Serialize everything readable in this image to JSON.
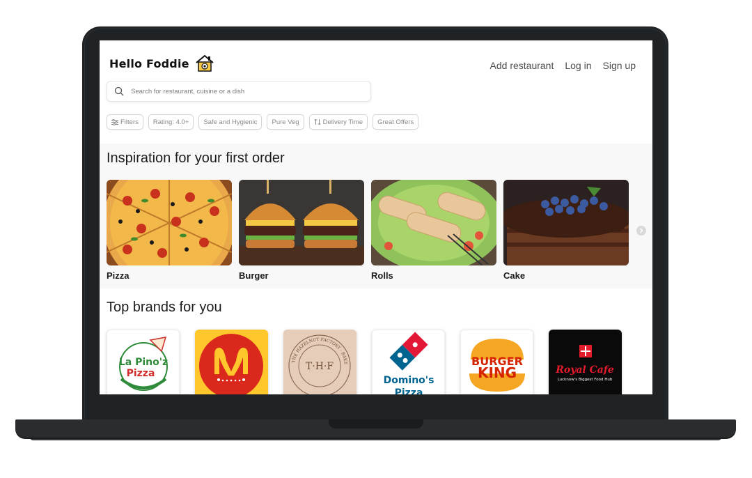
{
  "header": {
    "brand_name": "Hello Foddie",
    "nav": [
      "Add restaurant",
      "Log in",
      "Sign up"
    ]
  },
  "search": {
    "placeholder": "Search for restaurant, cuisine or a dish"
  },
  "filters": [
    "Filters",
    "Rating: 4.0+",
    "Safe and Hygienic",
    "Pure Veg",
    "Delivery Time",
    "Great Offers"
  ],
  "inspiration": {
    "title": "Inspiration for your first order",
    "items": [
      "Pizza",
      "Burger",
      "Rolls",
      "Cake"
    ]
  },
  "brands": {
    "title": "Top brands for you",
    "items": [
      "La Pino'z Pizza",
      "McDonald's",
      "The Hazelnut Factory",
      "Domino's Pizza",
      "Burger King",
      "Royal Cafe"
    ],
    "logo_text": {
      "lapinoz_line1": "La Pino'z",
      "lapinoz_line2": "Pizza",
      "thf": "T·H·F",
      "thf_ring": "THE HAZELNUT FACTORY · BAKERY AND SWEETS",
      "dominos_line1": "Domino's",
      "dominos_line2": "Pizza",
      "bk_line1": "BURGER",
      "bk_line2": "KING",
      "royal": "Royal Cafe",
      "royal_tag": "Lucknow's Biggest Food Hub"
    }
  },
  "colors": {
    "laptop_frame": "#1f2326",
    "section_bg": "#f8f8f8",
    "mcd_red": "#da291c",
    "mcd_yellow": "#ffc72c",
    "dominos_blue": "#006491",
    "dominos_red": "#e31837",
    "bk_orange": "#f5a623",
    "bk_red": "#d62300"
  },
  "icons": [
    "house-logo-icon",
    "search-icon",
    "filter-sliders-icon",
    "sort-icon",
    "chevron-right-icon"
  ]
}
